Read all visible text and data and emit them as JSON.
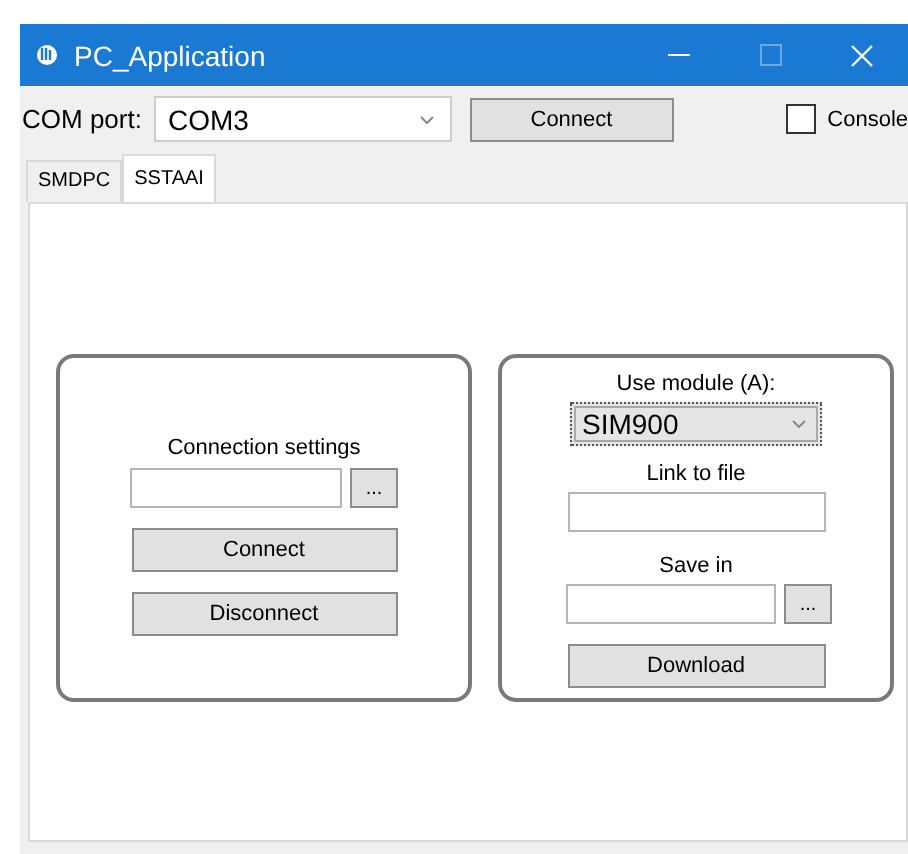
{
  "window": {
    "title": "PC_Application"
  },
  "toolbar": {
    "com_port_label": "COM port:",
    "com_port_value": "COM3",
    "connect_button": "Connect",
    "console_checkbox": {
      "label": "Console",
      "checked": false
    }
  },
  "tabs": [
    {
      "label": "SMDPC",
      "selected": false
    },
    {
      "label": "SSTAAI",
      "selected": true
    }
  ],
  "connection_group": {
    "title": "Connection settings",
    "browse_button": "...",
    "connect_button": "Connect",
    "disconnect_button": "Disconnect"
  },
  "download_group": {
    "module_label": "Use module (A):",
    "module_value": "SIM900",
    "link_label": "Link to file",
    "save_label": "Save in",
    "browse_button": "...",
    "download_button": "Download"
  }
}
